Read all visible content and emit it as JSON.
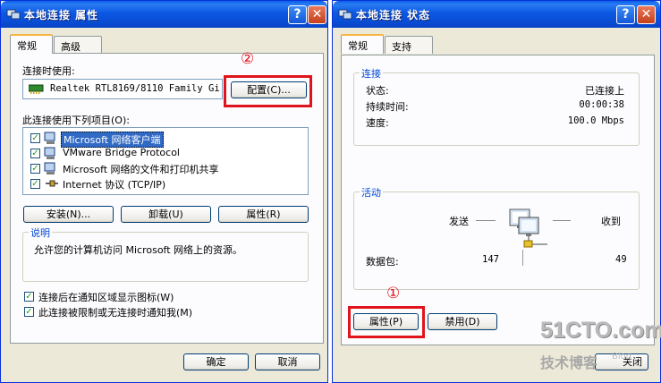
{
  "left": {
    "title": "本地连接  属性",
    "help_btn": "?",
    "close_btn": "✕",
    "tabs": [
      "常规",
      "高级"
    ],
    "connect_using_label": "连接时使用:",
    "adapter_name": "Realtek RTL8169/8110 Family Gi",
    "configure_btn": "配置(C)...",
    "components_label": "此连接使用下列项目(O):",
    "components": [
      {
        "label": "Microsoft 网络客户端",
        "checked": true,
        "selected": true
      },
      {
        "label": "VMware Bridge Protocol",
        "checked": true,
        "selected": false
      },
      {
        "label": "Microsoft 网络的文件和打印机共享",
        "checked": true,
        "selected": false
      },
      {
        "label": "Internet 协议 (TCP/IP)",
        "checked": true,
        "selected": false
      }
    ],
    "install_btn": "安装(N)...",
    "uninstall_btn": "卸载(U)",
    "properties_btn": "属性(R)",
    "description_title": "说明",
    "description_text": "允许您的计算机访问 Microsoft 网络上的资源。",
    "show_icon_label": "连接后在通知区域显示图标(W)",
    "notify_label": "此连接被限制或无连接时通知我(M)",
    "ok_btn": "确定",
    "cancel_btn": "取消",
    "annotation": "②"
  },
  "right": {
    "title": "本地连接 状态",
    "help_btn": "?",
    "close_btn": "✕",
    "tabs": [
      "常规",
      "支持"
    ],
    "connection_group": "连接",
    "status_label": "状态:",
    "status_value": "已连接上",
    "duration_label": "持续时间:",
    "duration_value": "00:00:38",
    "speed_label": "速度:",
    "speed_value": "100.0 Mbps",
    "activity_group": "活动",
    "sent_label": "发送",
    "received_label": "收到",
    "packets_label": "数据包:",
    "packets_sent": "147",
    "packets_received": "49",
    "properties_btn": "属性(P)",
    "disable_btn": "禁用(D)",
    "close_btn_label": "关闭",
    "annotation": "①"
  },
  "watermark": {
    "site": "51CTO.com",
    "blog": "技术博客",
    "blog_en": "Blog"
  },
  "colors": {
    "title_bar": "#0a50d8",
    "dialog_bg": "#ece9d8",
    "annotation_red": "#e0141c",
    "group_title": "#0046d5"
  }
}
